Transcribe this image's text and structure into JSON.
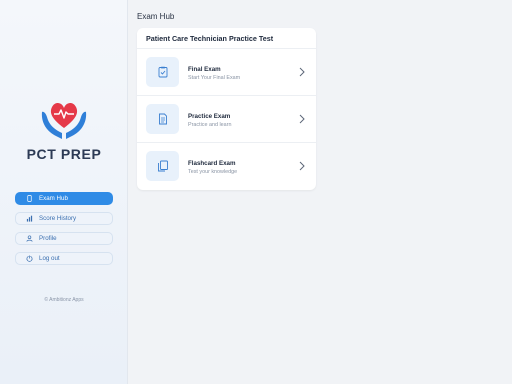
{
  "brand": {
    "name": "PCT PREP"
  },
  "sidebar": {
    "items": [
      {
        "label": "Exam Hub",
        "icon": "phone-icon",
        "active": true
      },
      {
        "label": "Score History",
        "icon": "chart-icon",
        "active": false
      },
      {
        "label": "Profile",
        "icon": "user-icon",
        "active": false
      },
      {
        "label": "Log out",
        "icon": "logout-icon",
        "active": false
      }
    ],
    "copyright": "© Ambitionz Apps"
  },
  "main": {
    "title": "Exam Hub",
    "card_title": "Patient Care Technician Practice Test",
    "exams": [
      {
        "name": "Final Exam",
        "subtitle": "Start Your Final Exam",
        "icon": "clipboard-check-icon"
      },
      {
        "name": "Practice Exam",
        "subtitle": "Practice and learn",
        "icon": "document-icon"
      },
      {
        "name": "Flashcard Exam",
        "subtitle": "Test your knowledge",
        "icon": "cards-icon"
      }
    ]
  },
  "colors": {
    "accent": "#2f8be6",
    "heart": "#e53948",
    "hands": "#2f7fd8",
    "sidebar_bg": "#eef3fa",
    "icon_box_bg": "#e8f1fb"
  }
}
